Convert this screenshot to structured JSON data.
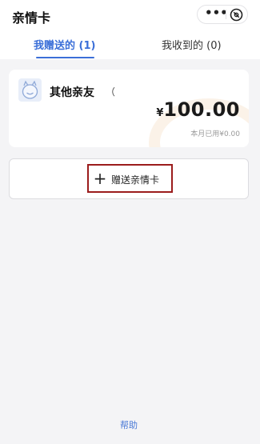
{
  "header": {
    "title": "亲情卡",
    "more_glyph": "•••",
    "more_icon": "more-dots-icon",
    "close_icon": "close-circle-icon"
  },
  "tabs": [
    {
      "label": "我赠送的 (1)",
      "active": true
    },
    {
      "label": "我收到的 (0)",
      "active": false
    }
  ],
  "card": {
    "avatar_icon": "smiley-avatar-icon",
    "member_name": "其他亲友",
    "member_note": "（",
    "currency": "¥",
    "amount": "100.00",
    "used_this_month": "本月已用¥0.00"
  },
  "gift_button": {
    "plus_glyph": "+",
    "label": "赠送亲情卡"
  },
  "footer": {
    "help_link": "帮助"
  },
  "colors": {
    "accent": "#3b6fd8",
    "highlight_box": "#9b1c1c",
    "background": "#f4f4f6"
  }
}
